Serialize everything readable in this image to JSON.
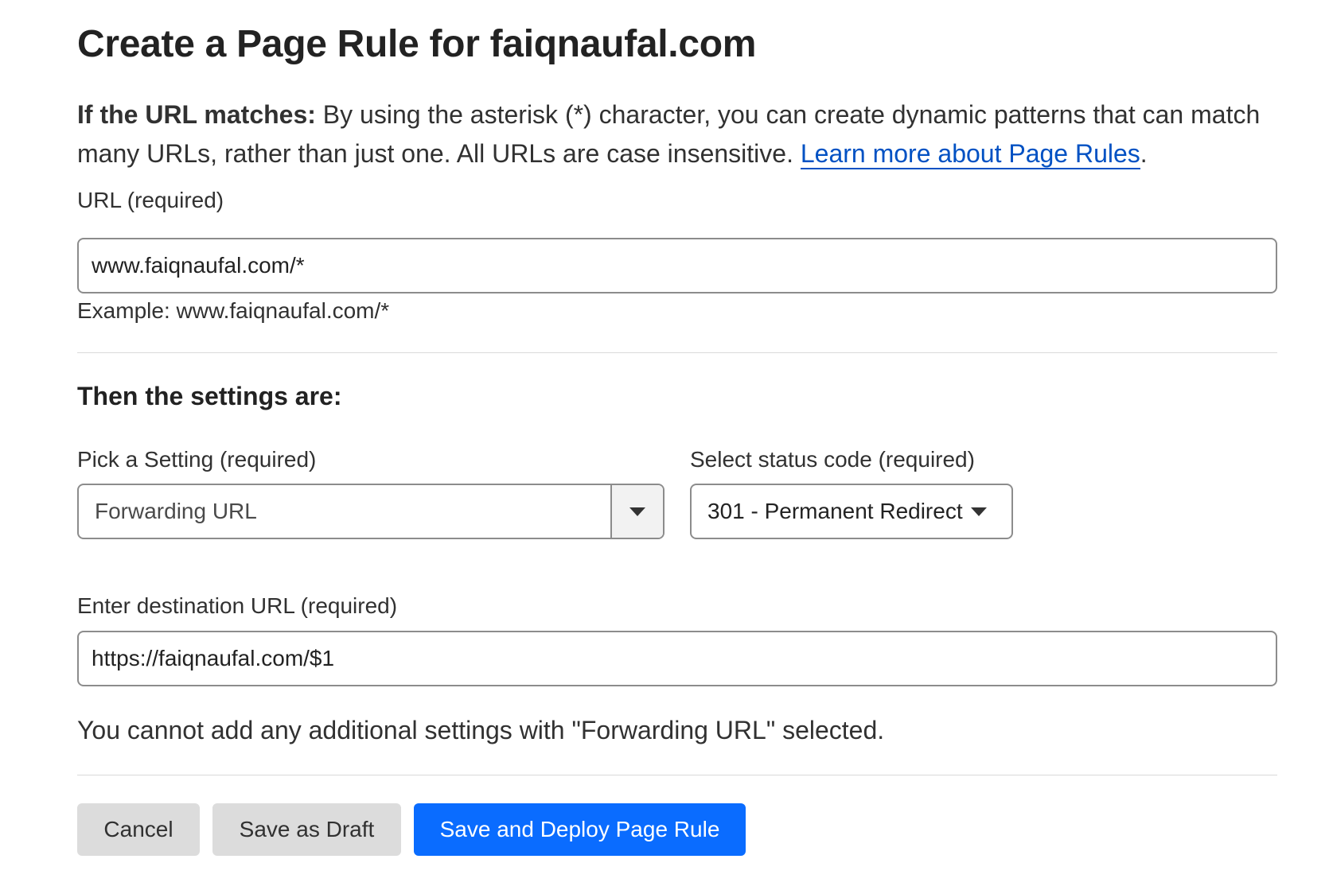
{
  "title": "Create a Page Rule for faiqnaufal.com",
  "intro": {
    "bold": "If the URL matches:",
    "text": " By using the asterisk (*) character, you can create dynamic patterns that can match many URLs, rather than just one. All URLs are case insensitive. ",
    "link": "Learn more about Page Rules",
    "trailing": "."
  },
  "url_field": {
    "label": "URL (required)",
    "value": "www.faiqnaufal.com/*",
    "example": "Example: www.faiqnaufal.com/*"
  },
  "settings_heading": "Then the settings are:",
  "setting_select": {
    "label": "Pick a Setting (required)",
    "value": "Forwarding URL"
  },
  "status_select": {
    "label": "Select status code (required)",
    "value": "301 - Permanent Redirect"
  },
  "destination_field": {
    "label": "Enter destination URL (required)",
    "value": "https://faiqnaufal.com/$1"
  },
  "note": "You cannot add any additional settings with \"Forwarding URL\" selected.",
  "buttons": {
    "cancel": "Cancel",
    "draft": "Save as Draft",
    "deploy": "Save and Deploy Page Rule"
  },
  "colors": {
    "link": "#0051c3",
    "primary_button": "#0a6cff",
    "secondary_button": "#dcdcdc"
  },
  "icons": {
    "select_arrow": "caret-down-icon",
    "status_arrow": "caret-down-icon"
  }
}
